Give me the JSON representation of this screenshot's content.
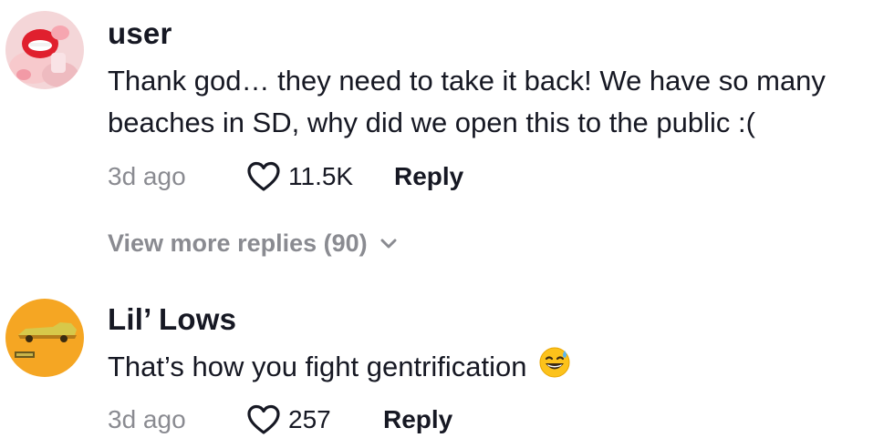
{
  "comments": [
    {
      "username": "user",
      "text": "Thank god… they need to take it back! We have so many beaches in SD, why did we open this to the public :(",
      "time": "3d ago",
      "likes": "11.5K",
      "reply_label": "Reply"
    },
    {
      "username": "Lil’ Lows",
      "text": "That’s how you fight gentrification",
      "emoji": "grinning-sweat-emoji",
      "time": "3d ago",
      "likes": "257",
      "reply_label": "Reply"
    }
  ],
  "view_more_replies": "View more replies (90)",
  "icons": {
    "like": "heart-outline-icon",
    "expand": "chevron-down-icon"
  },
  "colors": {
    "text": "#161823",
    "muted": "#8a8b91",
    "avatar2_bg": "#f5a623"
  }
}
